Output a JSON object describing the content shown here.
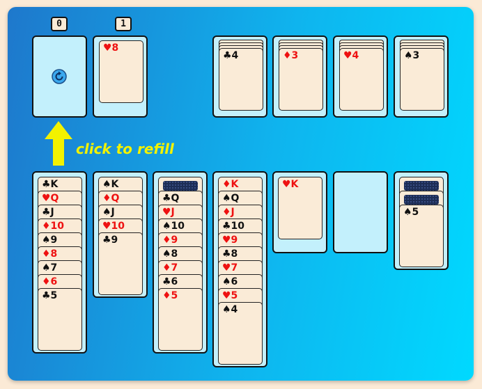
{
  "hint_text": "click to refill",
  "counters": {
    "stock": "0",
    "waste": "1"
  },
  "icons": {
    "refill": "refresh-icon",
    "hint_arrow": "up-arrow-icon"
  },
  "colors": {
    "board_start": "#1e78cc",
    "board_end": "#00d9ff",
    "slot": "#c3f0fc",
    "card": "#faebd7",
    "red": "#ee1111",
    "hint": "#f2f200"
  },
  "waste": {
    "card": "♥8"
  },
  "foundations": [
    {
      "suit": "clubs",
      "top": "♣4"
    },
    {
      "suit": "diamonds",
      "top": "♦3"
    },
    {
      "suit": "hearts",
      "top": "♥4"
    },
    {
      "suit": "spades",
      "top": "♠3"
    }
  ],
  "tableau": [
    {
      "facedown": 0,
      "cards": [
        "♣K",
        "♥Q",
        "♣J",
        "♦10",
        "♠9",
        "♦8",
        "♠7",
        "♦6",
        "♣5"
      ]
    },
    {
      "facedown": 0,
      "cards": [
        "♠K",
        "♦Q",
        "♠J",
        "♥10",
        "♣9"
      ]
    },
    {
      "facedown": 1,
      "cards": [
        "♣Q",
        "♥J",
        "♠10",
        "♦9",
        "♠8",
        "♦7",
        "♣6",
        "♦5"
      ]
    },
    {
      "facedown": 0,
      "cards": [
        "♦K",
        "♠Q",
        "♦J",
        "♣10",
        "♥9",
        "♣8",
        "♥7",
        "♠6",
        "♥5",
        "♠4"
      ]
    },
    {
      "facedown": 0,
      "cards": [
        "♥K"
      ]
    },
    {
      "facedown": 0,
      "cards": []
    },
    {
      "facedown": 2,
      "cards": [
        "♠5"
      ]
    }
  ]
}
